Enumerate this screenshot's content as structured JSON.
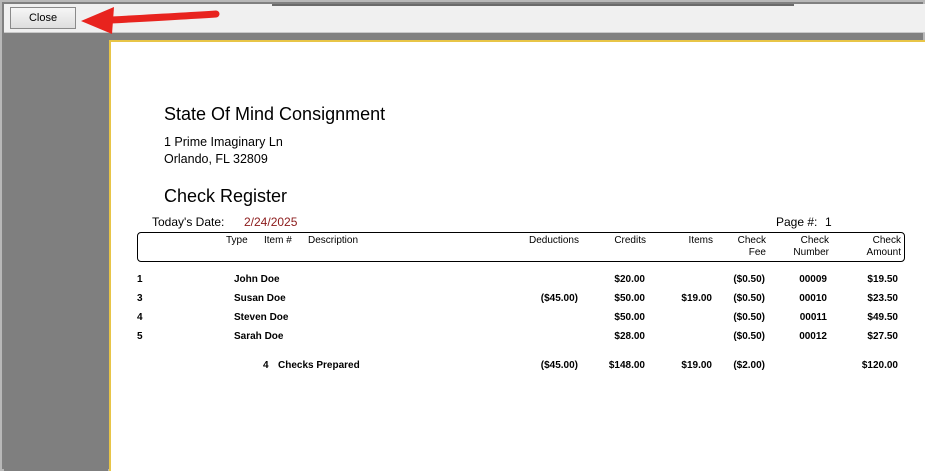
{
  "toolbar": {
    "close_label": "Close"
  },
  "report": {
    "company_name": "State Of Mind Consignment",
    "address_line1": "1 Prime Imaginary Ln",
    "address_line2": "Orlando, FL  32809",
    "title": "Check Register",
    "date_label": "Today's Date:",
    "date_value": "2/24/2025",
    "page_label": "Page #:",
    "page_value": "1"
  },
  "columns": {
    "type": "Type",
    "item": "Item #",
    "description": "Description",
    "deductions": "Deductions",
    "credits": "Credits",
    "items": "Items",
    "check_fee_1": "Check",
    "check_fee_2": "Fee",
    "check_number_1": "Check",
    "check_number_2": "Number",
    "check_amount_1": "Check",
    "check_amount_2": "Amount"
  },
  "rows": [
    {
      "id": "1",
      "name": "John Doe",
      "deductions": "",
      "credits": "$20.00",
      "items": "",
      "fee": "($0.50)",
      "number": "00009",
      "amount": "$19.50"
    },
    {
      "id": "3",
      "name": "Susan Doe",
      "deductions": "($45.00)",
      "credits": "$50.00",
      "items": "$19.00",
      "fee": "($0.50)",
      "number": "00010",
      "amount": "$23.50"
    },
    {
      "id": "4",
      "name": "Steven Doe",
      "deductions": "",
      "credits": "$50.00",
      "items": "",
      "fee": "($0.50)",
      "number": "00011",
      "amount": "$49.50"
    },
    {
      "id": "5",
      "name": "Sarah Doe",
      "deductions": "",
      "credits": "$28.00",
      "items": "",
      "fee": "($0.50)",
      "number": "00012",
      "amount": "$27.50"
    }
  ],
  "totals": {
    "count": "4",
    "label": "Checks Prepared",
    "deductions": "($45.00)",
    "credits": "$148.00",
    "items": "$19.00",
    "fee": "($2.00)",
    "amount": "$120.00"
  },
  "colors": {
    "accent_border": "#e8c547",
    "date_color": "#8b1a1a",
    "arrow_color": "#e8231e"
  }
}
